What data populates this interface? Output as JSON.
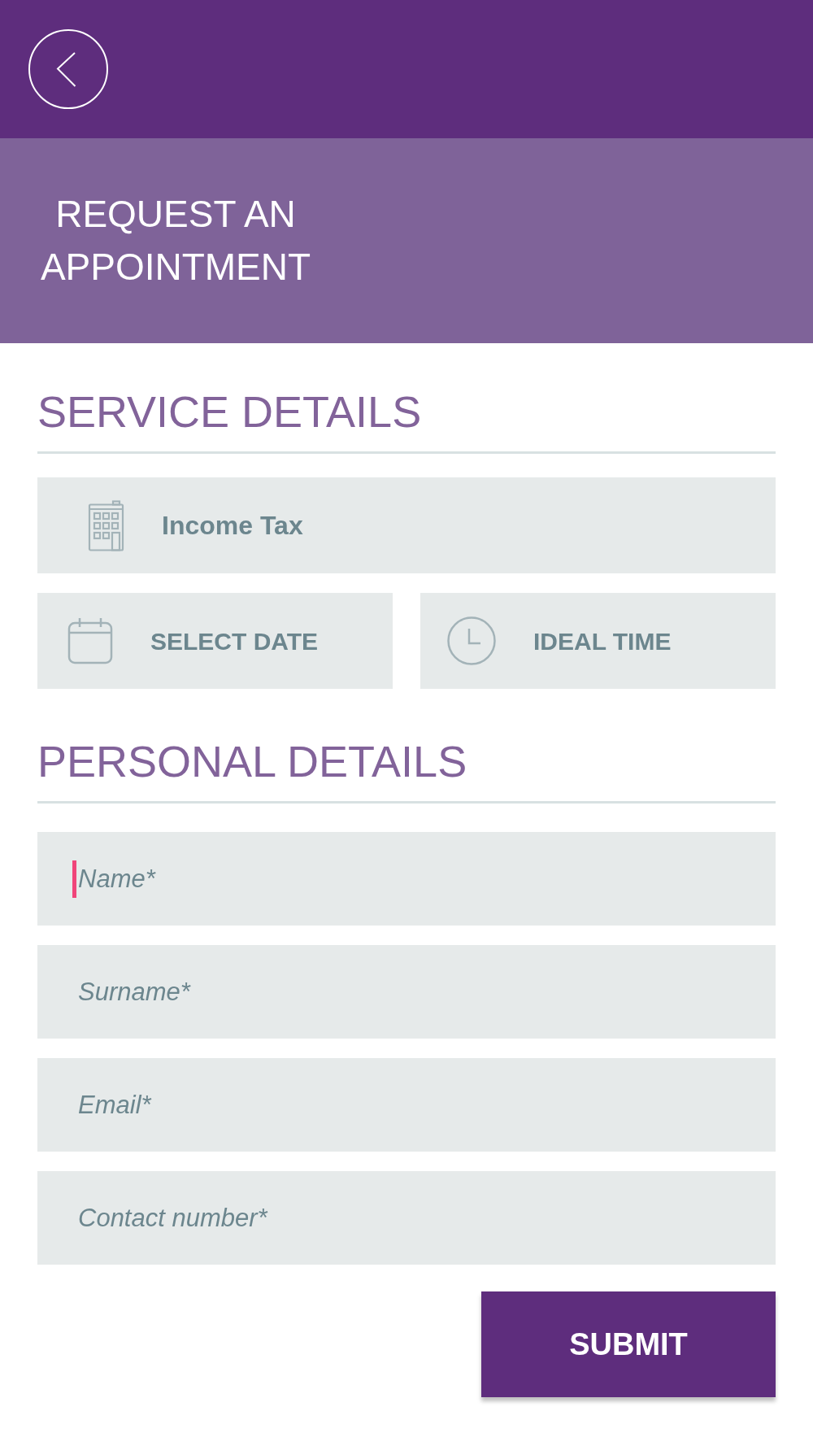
{
  "title": "REQUEST AN APPOINTMENT",
  "service_details": {
    "heading": "SERVICE DETAILS",
    "service": {
      "label": "Income Tax"
    },
    "pickers": [
      {
        "kind": "date",
        "label": "SELECT DATE"
      },
      {
        "kind": "time",
        "label": "IDEAL TIME"
      }
    ]
  },
  "personal_details": {
    "heading": "PERSONAL DETAILS",
    "fields": [
      {
        "placeholder": "Name*",
        "focused": true
      },
      {
        "placeholder": "Surname*",
        "focused": false
      },
      {
        "placeholder": "Email*",
        "focused": false
      },
      {
        "placeholder": "Contact number*",
        "focused": false
      }
    ]
  },
  "submit_button": {
    "label": "SUBMIT"
  }
}
